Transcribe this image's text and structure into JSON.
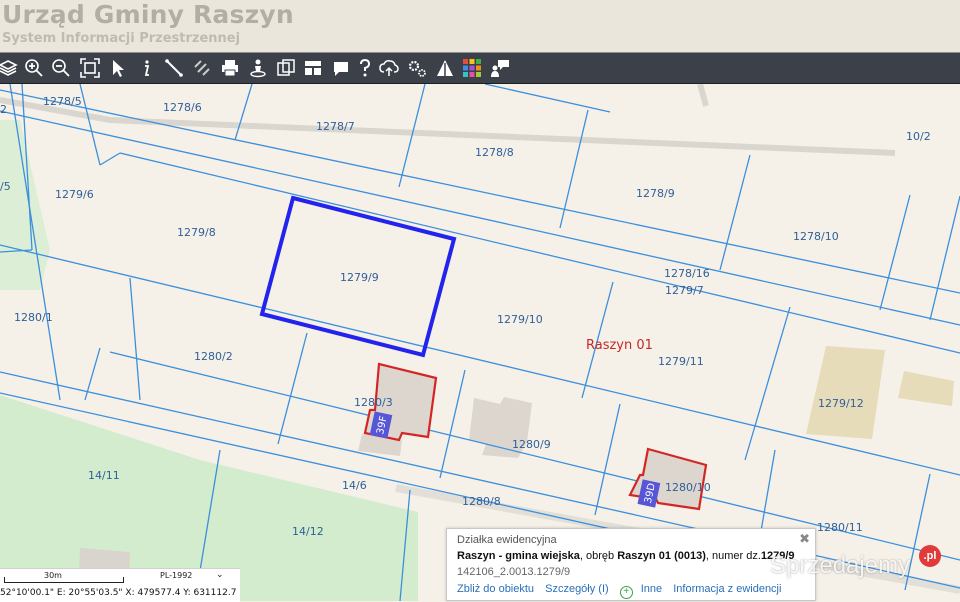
{
  "header": {
    "title": "Urząd Gminy Raszyn",
    "subtitle": "System Informacji Przestrzennej"
  },
  "toolbar": {
    "tools": [
      {
        "name": "layers-icon"
      },
      {
        "name": "zoom-in-icon"
      },
      {
        "name": "zoom-out-icon"
      },
      {
        "name": "zoom-extent-icon"
      },
      {
        "name": "select-arrow-icon"
      },
      {
        "name": "info-icon"
      },
      {
        "name": "measure-icon"
      },
      {
        "name": "link-icon"
      },
      {
        "name": "print-icon"
      },
      {
        "name": "locate-person-icon"
      },
      {
        "name": "copy-icon"
      },
      {
        "name": "layout-icon"
      },
      {
        "name": "comment-icon"
      },
      {
        "name": "help-icon"
      },
      {
        "name": "cloud-upload-icon"
      },
      {
        "name": "settings-icon"
      },
      {
        "name": "map-sign-icon"
      },
      {
        "name": "color-palette-icon"
      },
      {
        "name": "chat-person-icon"
      }
    ]
  },
  "map": {
    "colors": {
      "background": "#f6f1e8",
      "green": "#d3ecce",
      "parcel_line": "#3b8fdc",
      "selected": "#2323ee",
      "building": "#dcd6cf",
      "building_edge": "#d42525",
      "sand": "#e6dcba"
    },
    "region_label": "Raszyn 01",
    "parcel_labels": {
      "p1": "1278/5",
      "p2": "1278/6",
      "p3": "1278/7",
      "p4": "1278/8",
      "p5": "1278/9",
      "p6": "10/2",
      "p7": "1279/6",
      "p8": "1279/8",
      "p9": "1279/9",
      "p10": "1278/10",
      "p11": "1278/16",
      "p12": "1279/7",
      "p13": "1279/10",
      "p14": "1280/1",
      "p15": "1280/2",
      "p16": "1279/11",
      "p17": "1280/3",
      "p18": "1279/12",
      "p19": "1280/9",
      "p20": "14/11",
      "p21": "14/6",
      "p22": "1280/8",
      "p23": "1280/10",
      "p24": "1280/11",
      "p25": "14/12",
      "p26": "2",
      "p27": "/5"
    },
    "house_numbers": {
      "h1": "39F",
      "h2": "39D"
    }
  },
  "scale": {
    "label": "30m",
    "crs": "PL-1992",
    "coords": "52°10'00.1\" E: 20°55'03.5\"  X: 479577.4   Y: 631112.7"
  },
  "popup": {
    "heading": "Działka ewidencyjna",
    "municipality": "Raszyn - gmina wiejska",
    "precinct_prefix": ", obręb ",
    "precinct": "Raszyn 01 (0013)",
    "number_prefix": ", numer dz.",
    "parcel_number": "1279/9",
    "id": "142106_2.0013.1279/9",
    "links": {
      "zoom": "Zbliż do obiektu",
      "details": "Szczegóły (I)",
      "other": "Inne",
      "register_info": "Informacja z ewidencji"
    }
  },
  "watermark": {
    "text": "Sprzedajemy",
    "badge": ".pl"
  }
}
